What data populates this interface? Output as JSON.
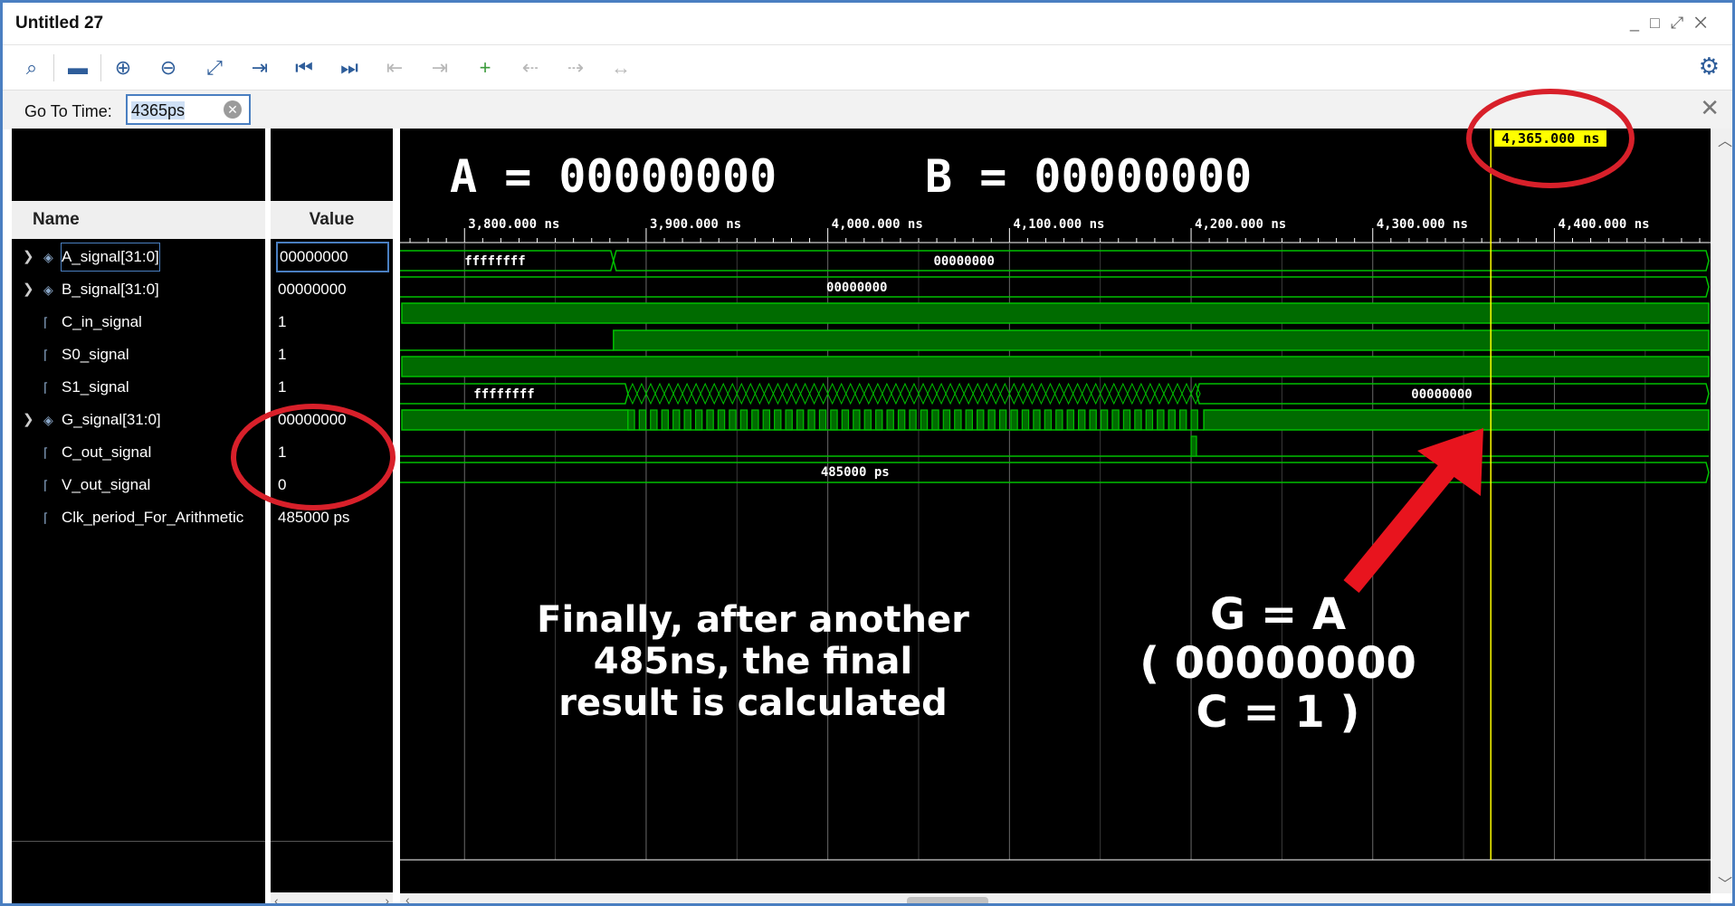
{
  "window": {
    "title": "Untitled 27",
    "controls": [
      "_",
      "□",
      "⤢",
      "✕"
    ]
  },
  "toolbar": {
    "icons": [
      "search-icon",
      "save-icon",
      "zoom-in-icon",
      "zoom-out-icon",
      "zoom-fit-icon",
      "go-to-cursor-icon",
      "go-to-time-zero-icon",
      "go-to-last-time-icon",
      "previous-transition-icon",
      "next-transition-icon",
      "add-marker-icon",
      "previous-marker-icon",
      "next-marker-icon",
      "swap-cursors-icon"
    ],
    "glyphs": [
      "⌕",
      "▬",
      "⊕",
      "⊖",
      "⤢",
      "⇥",
      "⏮",
      "⏭",
      "⇤",
      "⇥",
      "+",
      "⇠",
      "⇢",
      "↔"
    ],
    "settings_glyph": "⚙"
  },
  "goto": {
    "label": "Go To Time:",
    "value": "4365ps",
    "clear_glyph": "✕",
    "close_glyph": "✕"
  },
  "columns": {
    "name": "Name",
    "value": "Value"
  },
  "signals": [
    {
      "name": "A_signal[31:0]",
      "value": "00000000",
      "bus": true
    },
    {
      "name": "B_signal[31:0]",
      "value": "00000000",
      "bus": true
    },
    {
      "name": "C_in_signal",
      "value": "1",
      "bus": false
    },
    {
      "name": "S0_signal",
      "value": "1",
      "bus": false
    },
    {
      "name": "S1_signal",
      "value": "1",
      "bus": false
    },
    {
      "name": "G_signal[31:0]",
      "value": "00000000",
      "bus": true
    },
    {
      "name": "C_out_signal",
      "value": "1",
      "bus": false
    },
    {
      "name": "V_out_signal",
      "value": "0",
      "bus": false
    },
    {
      "name": "Clk_period_For_Arithmetic",
      "value": "485000 ps",
      "bus": false
    }
  ],
  "timeline": {
    "ticks": [
      "3,800.000 ns",
      "3,900.000 ns",
      "4,000.000 ns",
      "4,100.000 ns",
      "4,200.000 ns",
      "4,300.000 ns",
      "4,400.000 ns"
    ],
    "cursor_label": "4,365.000 ns"
  },
  "wave_labels": {
    "a_before": "ffffffff",
    "a_after": "00000000",
    "b": "00000000",
    "g_before": "ffffffff",
    "g_after": "00000000",
    "clk": "485000 ps"
  },
  "annotations": {
    "header_a": "A = 00000000",
    "header_b": "B = 00000000",
    "note_line1": "Finally, after another",
    "note_line2": "485ns, the final",
    "note_line3": "result is calculated",
    "result_line1": "G = A",
    "result_line2": "( 00000000",
    "result_line3": "C = 1 )"
  },
  "colors": {
    "wave": "#00c000",
    "wave_fill": "#006b00",
    "cursor": "#ffff00",
    "annotation_red": "#d8202a"
  }
}
